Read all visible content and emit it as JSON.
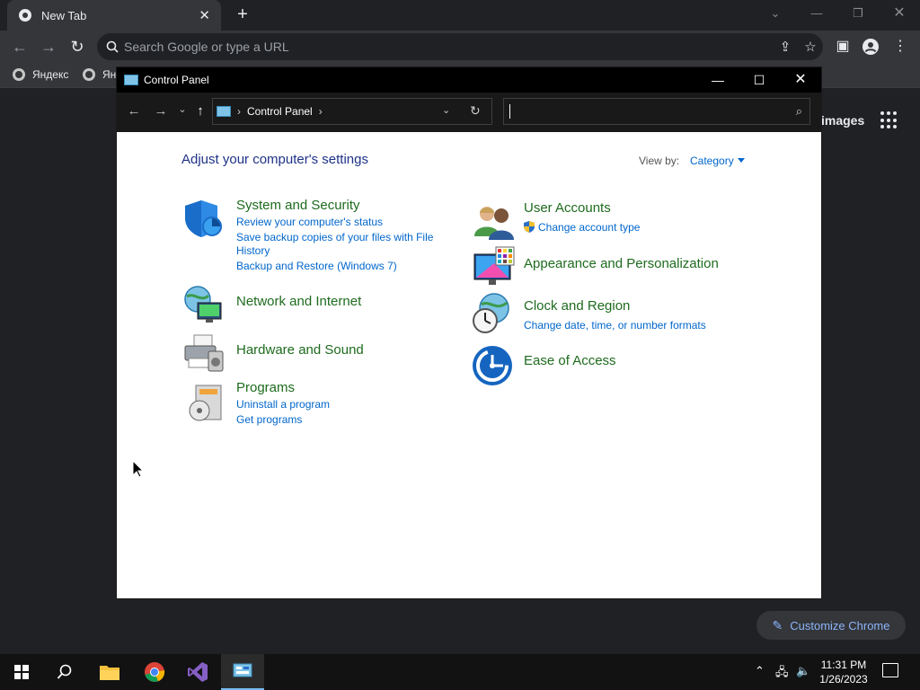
{
  "chrome": {
    "tab_title": "New Tab",
    "omnibox_placeholder": "Search Google or type a URL",
    "bookmarks": [
      "Яндекс",
      "Ян"
    ],
    "images_link": "images",
    "customize_label": "Customize Chrome"
  },
  "window": {
    "title": "Control Panel",
    "breadcrumb": "Control Panel",
    "search_value": ""
  },
  "content": {
    "heading": "Adjust your computer's settings",
    "view_by_label": "View by:",
    "view_by_value": "Category",
    "categories_left": [
      {
        "title": "System and Security",
        "links": [
          "Review your computer's status",
          "Save backup copies of your files with File",
          "History",
          "Backup and Restore (Windows 7)"
        ]
      },
      {
        "title": "Network and Internet",
        "links": []
      },
      {
        "title": "Hardware and Sound",
        "links": []
      },
      {
        "title": "Programs",
        "links": [
          "Uninstall a program",
          "Get programs"
        ]
      }
    ],
    "categories_right": [
      {
        "title": "User Accounts",
        "links": [
          "Change account type"
        ]
      },
      {
        "title": "Appearance and Personalization",
        "links": []
      },
      {
        "title": "Clock and Region",
        "links": [
          "Change date, time, or number formats"
        ]
      },
      {
        "title": "Ease of Access",
        "links": []
      }
    ]
  },
  "taskbar": {
    "time": "11:31 PM",
    "date": "1/26/2023"
  },
  "colors": {
    "category_title": "#1e6b1e",
    "link": "#0066cc",
    "heading": "#1e3287"
  }
}
